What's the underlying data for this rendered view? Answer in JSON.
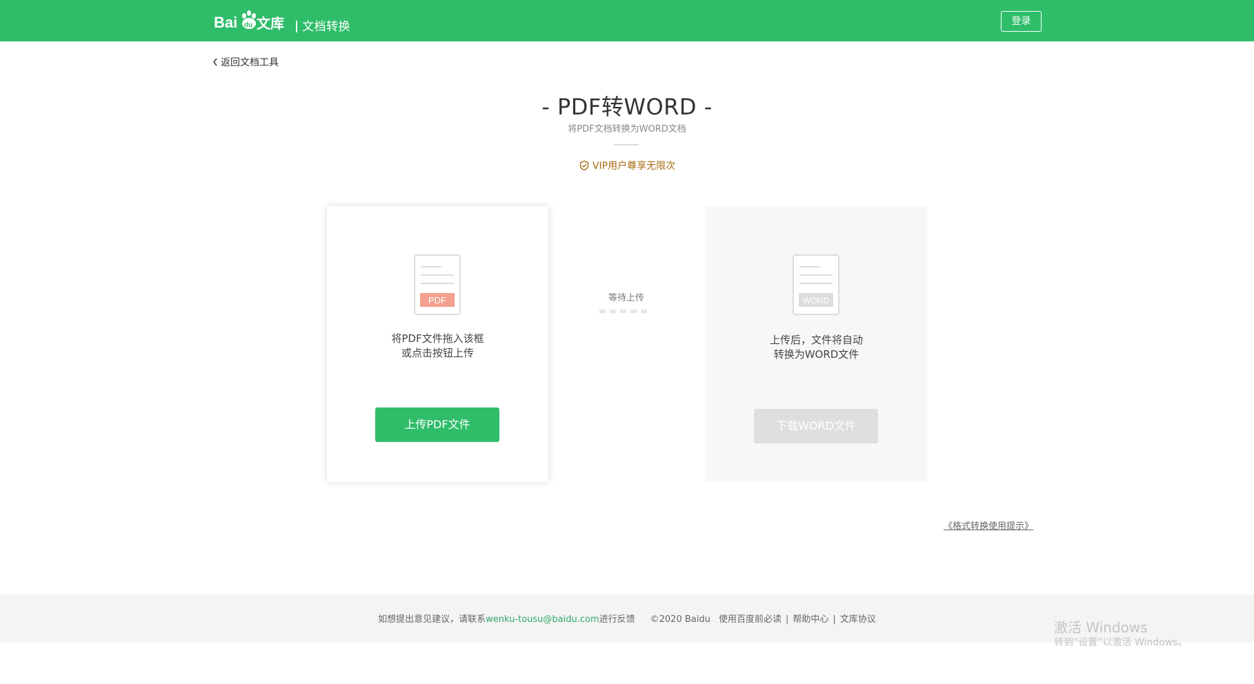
{
  "header": {
    "logo_text": "Bai du 文库",
    "section": "文档转换",
    "login_label": "登录",
    "brand_color": "#2fbd6a"
  },
  "nav": {
    "back_label": "返回文档工具"
  },
  "hero": {
    "title": "- PDF转WORD -",
    "subtitle": "将PDF文档转换为WORD文档",
    "vip_text": "VIP用户尊享无限次"
  },
  "upload_card": {
    "icon_label": "PDF",
    "line1": "将PDF文件拖入该框",
    "line2": "或点击按钮上传",
    "button_label": "上传PDF文件"
  },
  "status": {
    "text": "等待上传"
  },
  "download_card": {
    "icon_label": "WORD",
    "line1": "上传后，文件将自动",
    "line2": "转换为WORD文件",
    "button_label": "下载WORD文件"
  },
  "tips_link": "《格式转换使用提示》",
  "footer": {
    "feedback_prefix": "如想提出意见建议，请联系",
    "email": "wenku-tousu@baidu.com",
    "feedback_suffix": "进行反馈",
    "copyright": "©2020  Baidu",
    "link1": "使用百度前必读",
    "link2": "帮助中心",
    "link3": "文库协议"
  },
  "watermark": {
    "line1": "激活 Windows",
    "line2": "转到“设置”以激活 Windows。"
  }
}
